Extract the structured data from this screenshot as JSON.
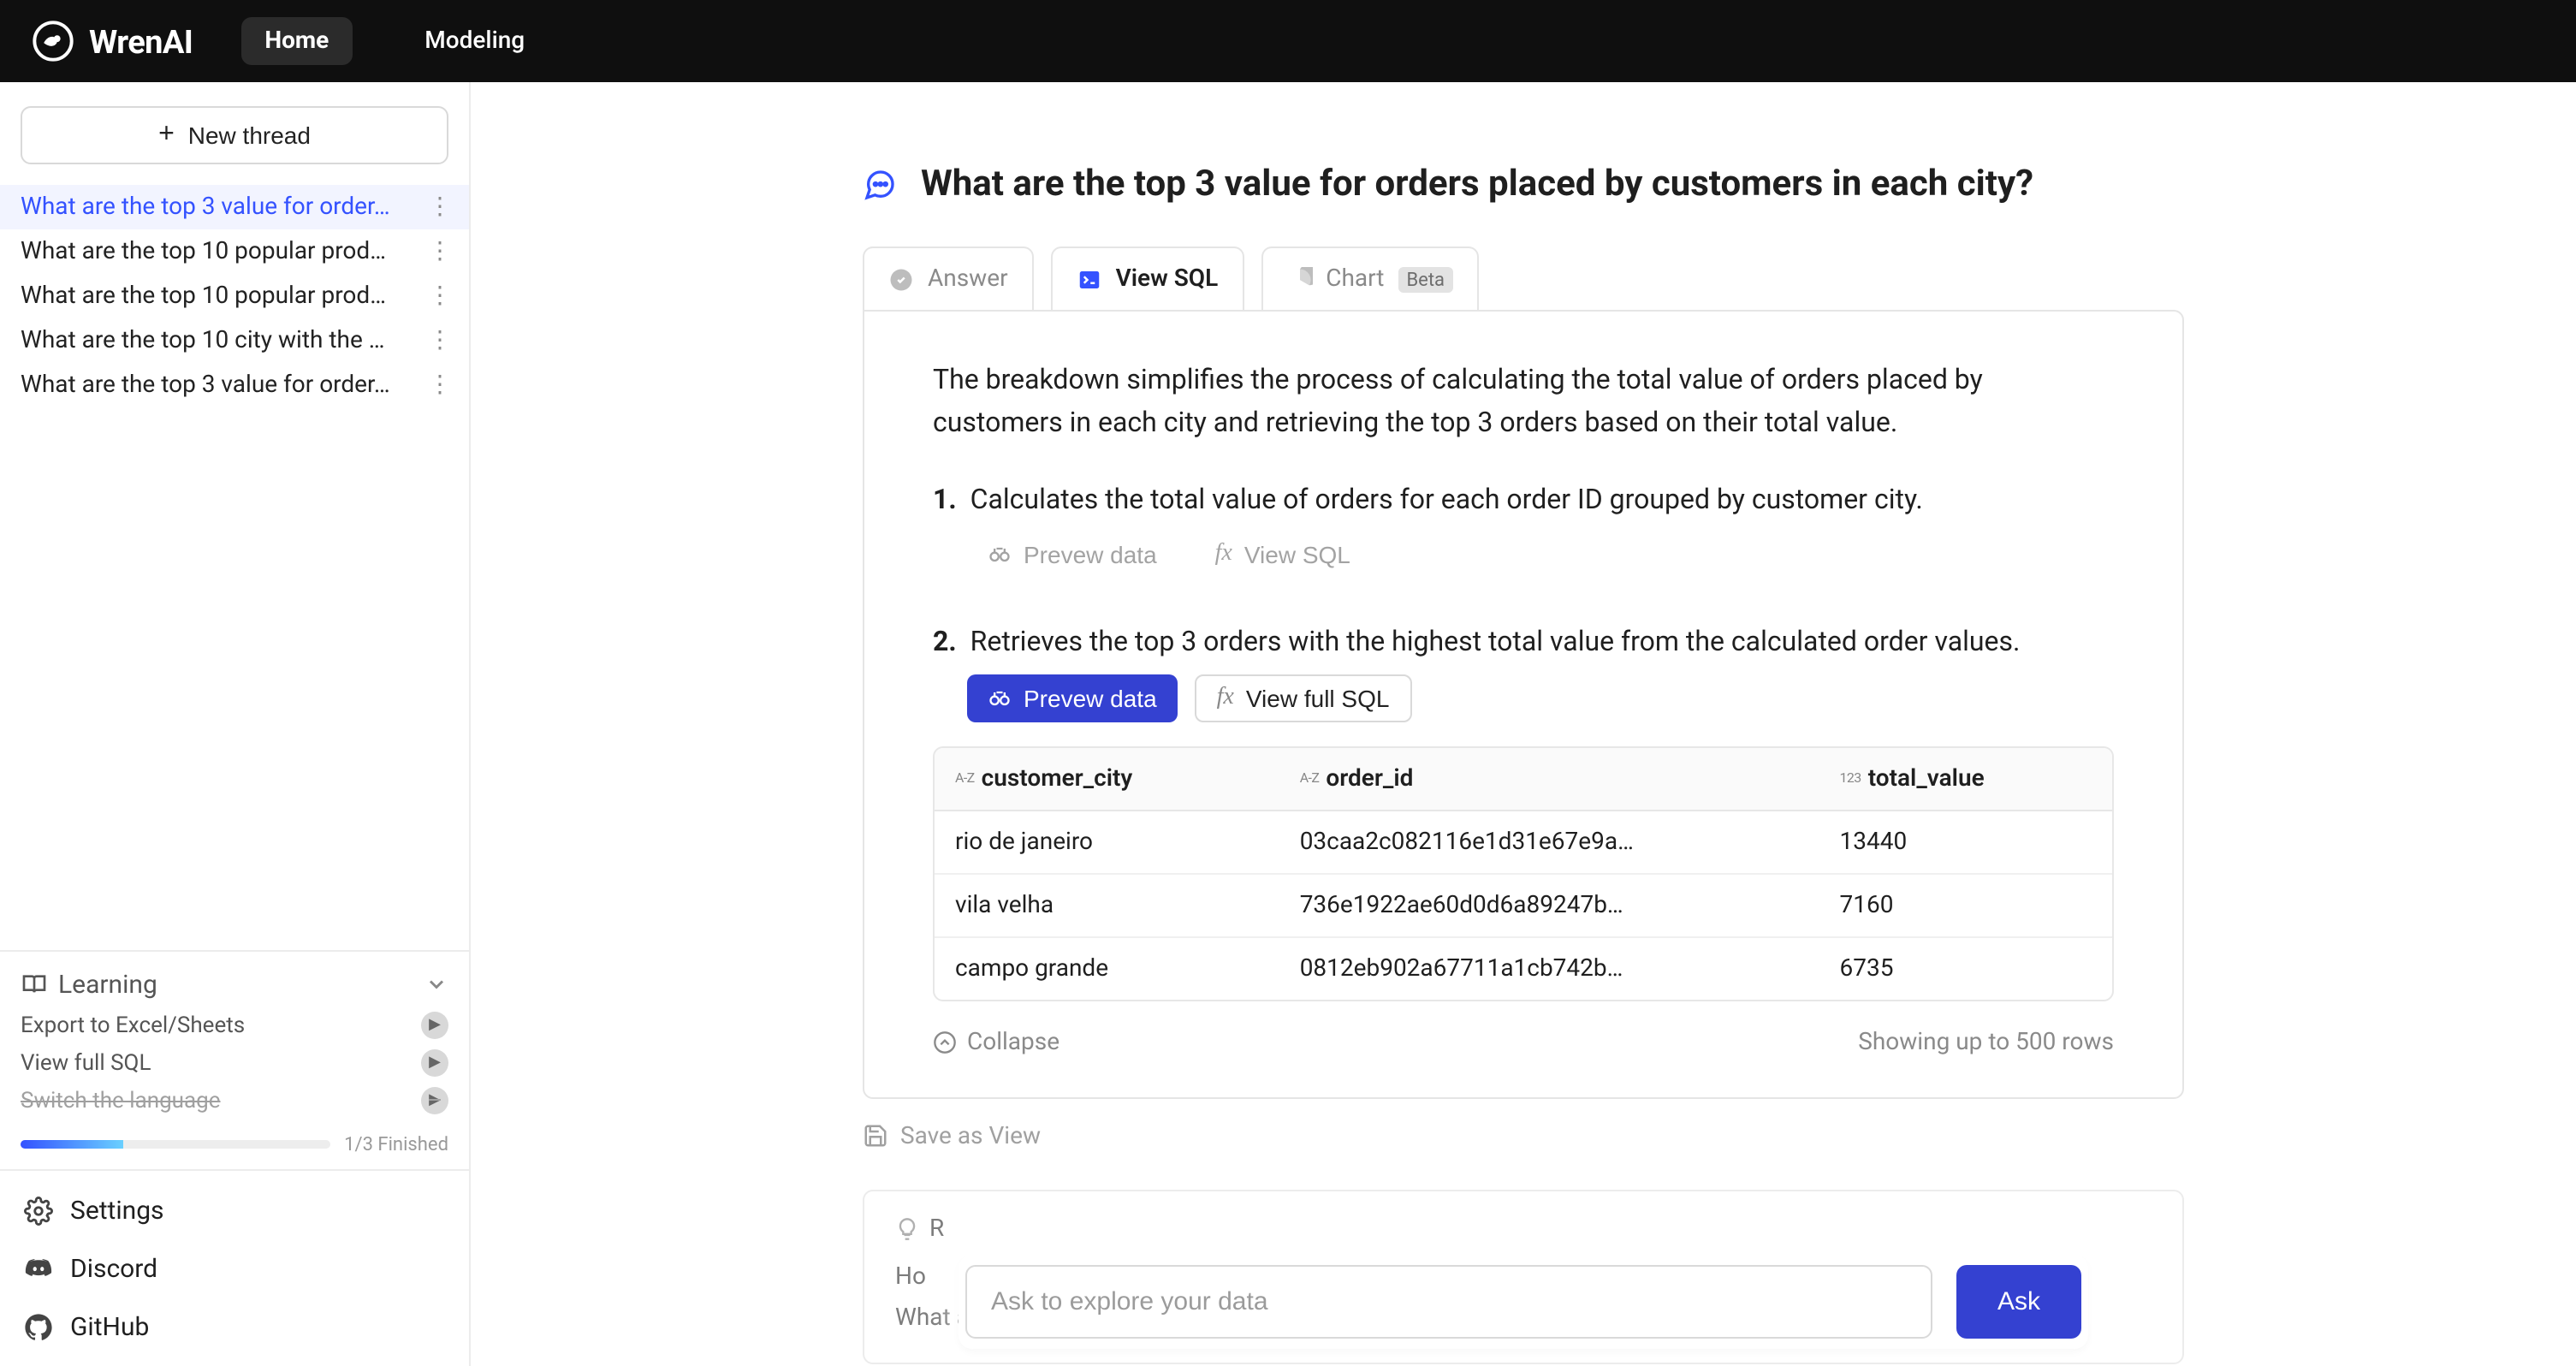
{
  "header": {
    "brand": "WrenAI",
    "nav": {
      "home": "Home",
      "modeling": "Modeling"
    }
  },
  "sidebar": {
    "new_thread": "New thread",
    "threads": [
      {
        "label": "What are the top 3 value for order…",
        "active": true
      },
      {
        "label": "What are the top 10 popular prod…",
        "active": false
      },
      {
        "label": "What are the top 10 popular prod…",
        "active": false
      },
      {
        "label": "What are the top 10 city with the …",
        "active": false
      },
      {
        "label": "What are the top 3 value for order…",
        "active": false
      }
    ],
    "learning": {
      "title": "Learning",
      "items": [
        {
          "label": "Export to Excel/Sheets",
          "done": false
        },
        {
          "label": "View full SQL",
          "done": false
        },
        {
          "label": "Switch the language",
          "done": true
        }
      ],
      "progress_label": "1/3 Finished"
    },
    "links": {
      "settings": "Settings",
      "discord": "Discord",
      "github": "GitHub"
    }
  },
  "question": "What are the top 3 value for orders placed by customers in each city?",
  "tabs": {
    "answer": "Answer",
    "view_sql": "View SQL",
    "chart": "Chart",
    "chart_badge": "Beta"
  },
  "explanation": {
    "summary": "The breakdown simplifies the process of calculating the total value of orders placed by customers in each city and retrieving the top 3 orders based on their total value.",
    "steps": [
      {
        "num": "1.",
        "text": "Calculates the total value of orders for each order ID grouped by customer city.",
        "preview_data_label": "Prevew data",
        "view_sql_label": "View SQL"
      },
      {
        "num": "2.",
        "text": "Retrieves the top 3 orders with the highest total value from the calculated order values.",
        "preview_data_label": "Prevew data",
        "view_full_sql_label": "View full SQL"
      }
    ],
    "columns": [
      {
        "type": "A-Z",
        "name": "customer_city"
      },
      {
        "type": "A-Z",
        "name": "order_id"
      },
      {
        "type": "123",
        "name": "total_value"
      }
    ],
    "rows": [
      {
        "customer_city": "rio de janeiro",
        "order_id": "03caa2c082116e1d31e67e9a…",
        "total_value": "13440"
      },
      {
        "customer_city": "vila velha",
        "order_id": "736e1922ae60d0d6a89247b…",
        "total_value": "7160"
      },
      {
        "customer_city": "campo grande",
        "order_id": "0812eb902a67711a1cb742b…",
        "total_value": "6735"
      }
    ],
    "collapse_label": "Collapse",
    "rows_note": "Showing up to 500 rows",
    "save_view_label": "Save as View"
  },
  "recommendations": {
    "title_initial": "R",
    "line1": "Ho",
    "line2": "What are the most common product categories purchased by customers in each city?"
  },
  "ask": {
    "placeholder": "Ask to explore your data",
    "button": "Ask"
  }
}
